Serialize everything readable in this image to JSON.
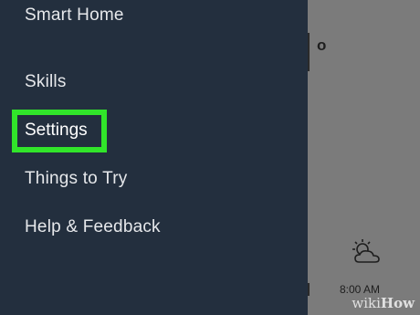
{
  "drawer": {
    "items": [
      {
        "label": "Smart Home"
      },
      {
        "label": "Skills"
      },
      {
        "label": "Settings",
        "highlighted": true
      },
      {
        "label": "Things to Try"
      },
      {
        "label": "Help & Feedback"
      }
    ],
    "background": "#232f3e",
    "highlight_color": "#31e52a"
  },
  "background_app": {
    "partial_text": "o",
    "time": "8:00 AM",
    "weather_icon": "partly-cloudy-icon"
  },
  "watermark": {
    "prefix": "wiki",
    "suffix": "How"
  }
}
